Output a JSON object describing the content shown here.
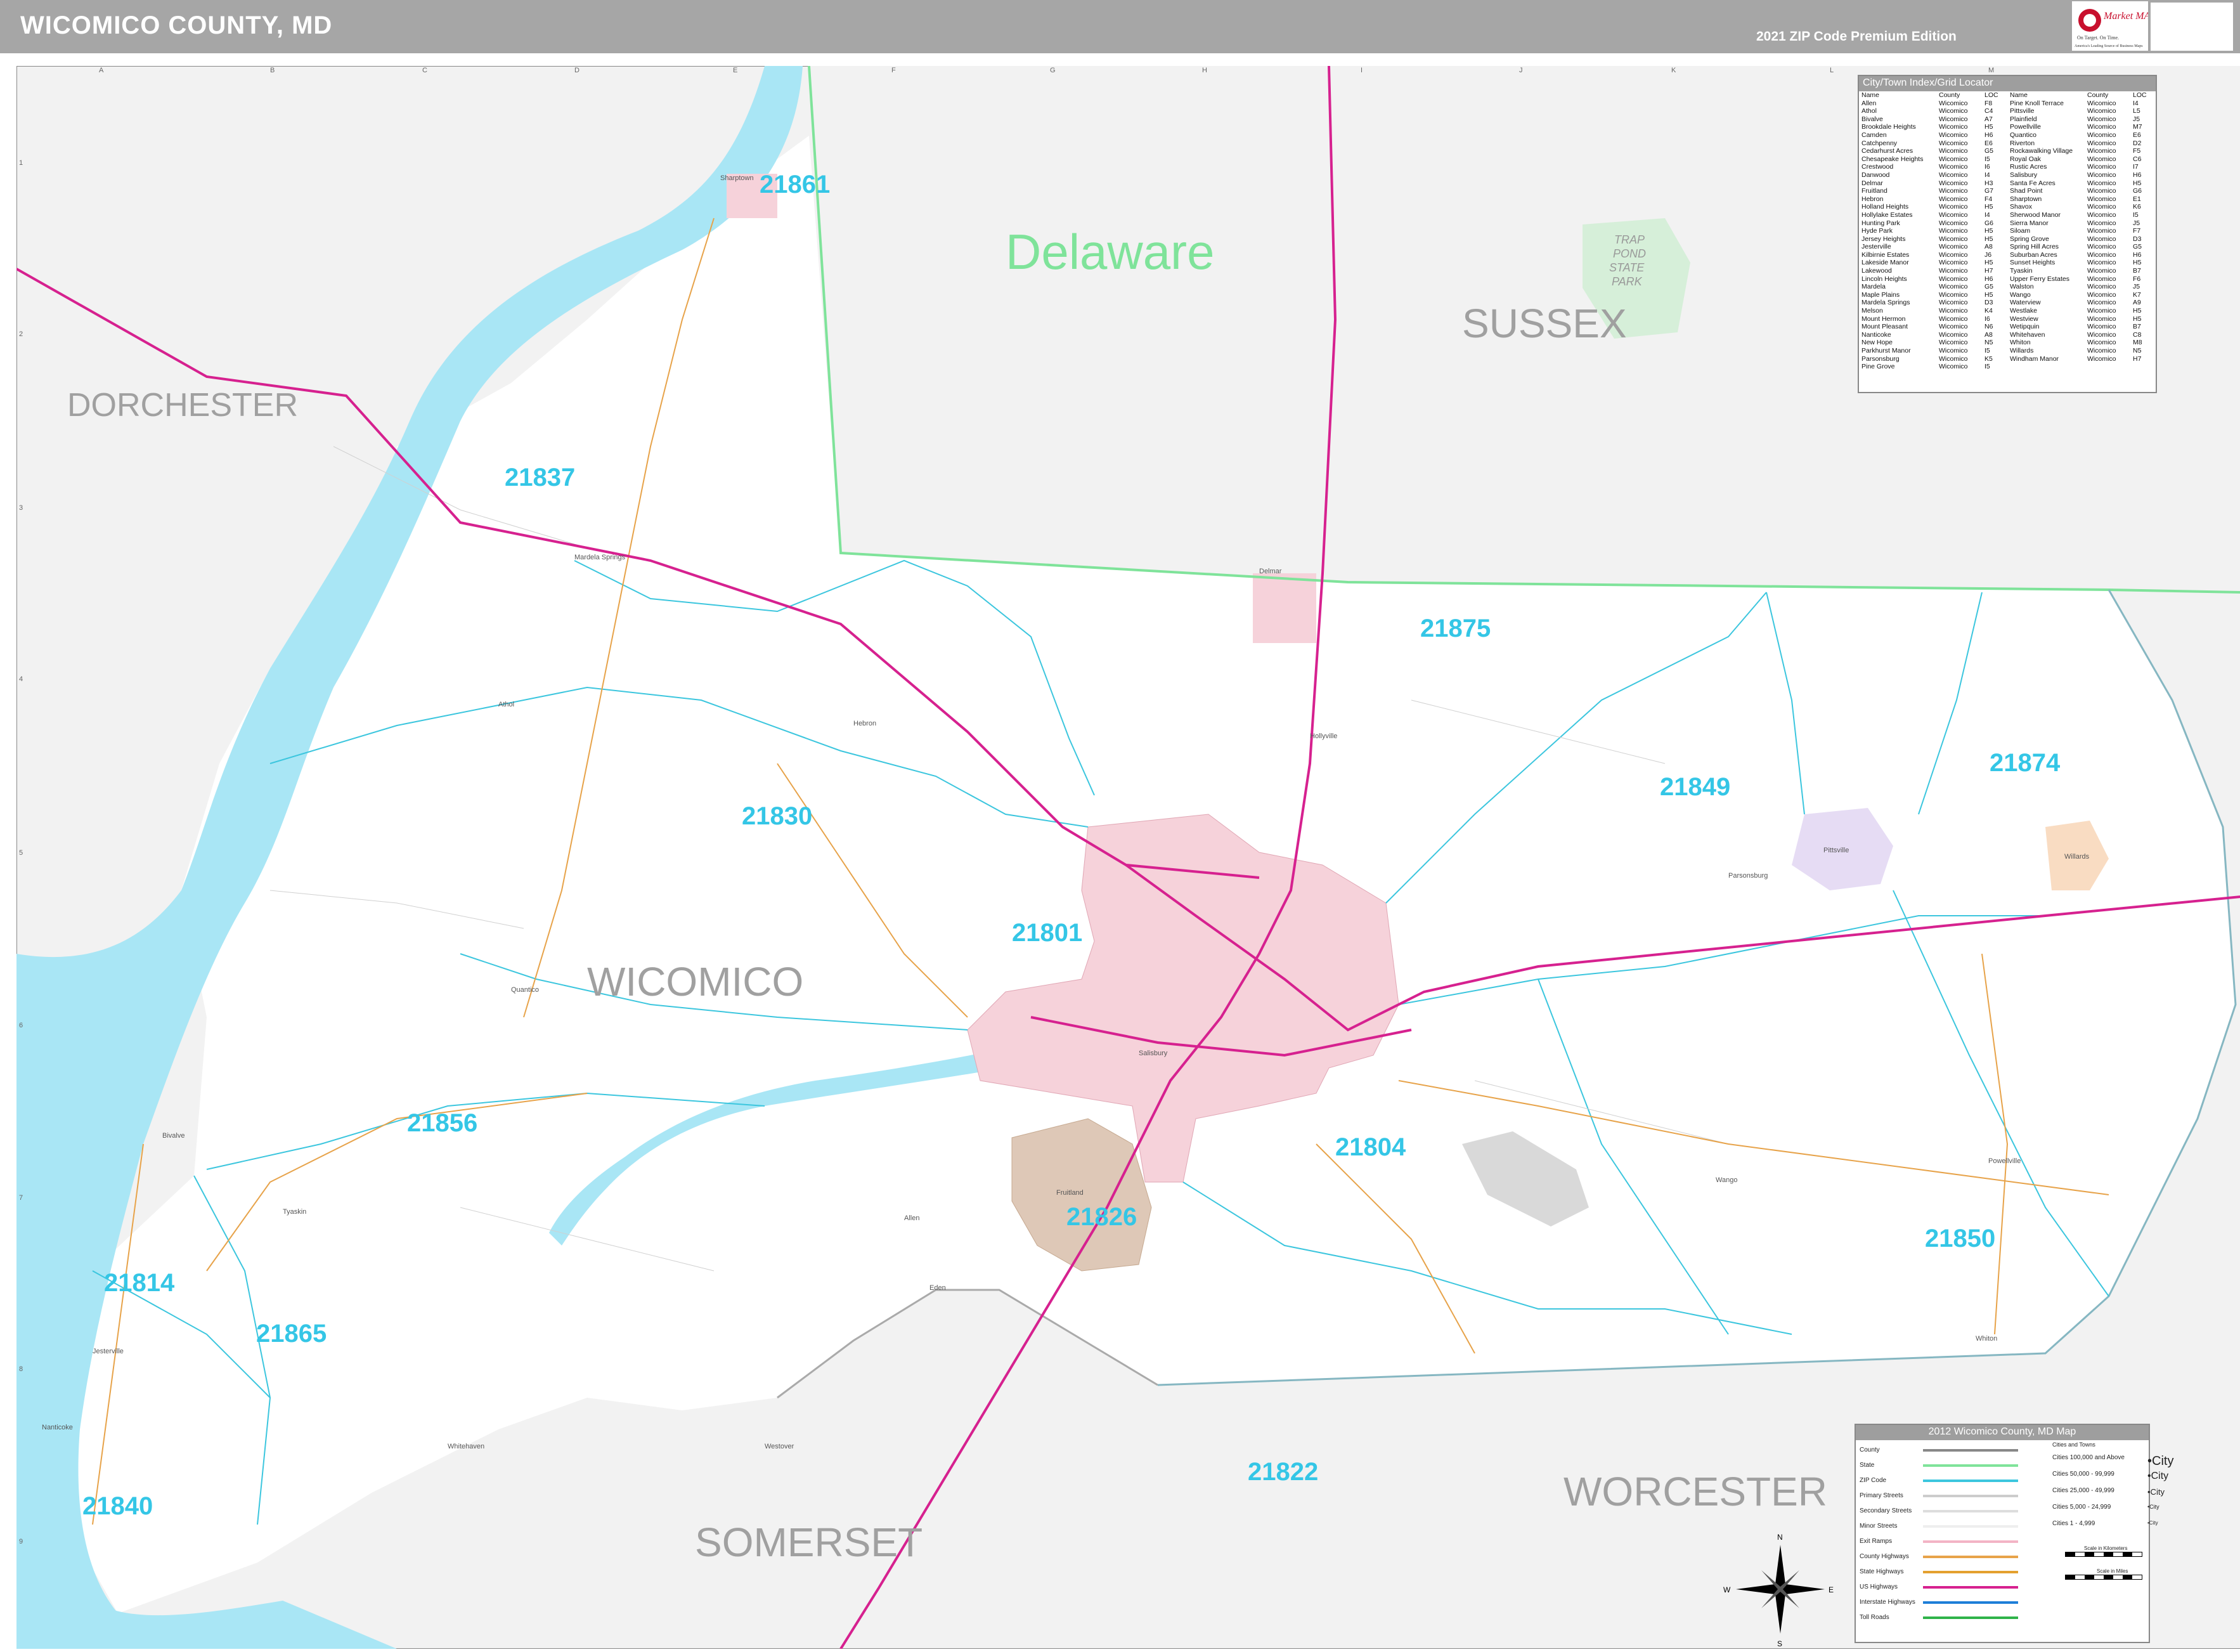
{
  "header": {
    "title": "WICOMICO COUNTY, MD",
    "edition": "2021 ZIP Code Premium Edition",
    "logo_text": "Market MAPS",
    "logo_tagline": "America's Leading Source of Business Maps",
    "logo_slogan": "On Target. On Time."
  },
  "grid": {
    "columns": [
      "A",
      "B",
      "C",
      "D",
      "E",
      "F",
      "G",
      "H",
      "I",
      "J",
      "K",
      "L",
      "M"
    ],
    "rows": [
      "1",
      "2",
      "3",
      "4",
      "5",
      "6",
      "7",
      "8",
      "9"
    ]
  },
  "map": {
    "state_label": "Delaware",
    "counties": [
      "DORCHESTER",
      "SUSSEX",
      "WICOMICO",
      "SOMERSET",
      "WORCESTER"
    ],
    "park_label": [
      "TRAP",
      "POND",
      "STATE",
      "PARK"
    ],
    "zip_codes": [
      "21861",
      "21837",
      "21875",
      "21874",
      "21849",
      "21830",
      "21801",
      "21856",
      "21804",
      "21826",
      "21850",
      "21814",
      "21865",
      "21840",
      "21822"
    ],
    "towns": [
      "Sharptown",
      "Mardela Springs",
      "Athol",
      "Hebron",
      "Delmar",
      "Salisbury",
      "Fruitland",
      "Allen",
      "Eden",
      "Tyaskin",
      "Nanticoke",
      "Whitehaven",
      "Quantico",
      "Pittsville",
      "Willards",
      "Parsonsburg",
      "Powellville",
      "Whiton",
      "Bivalve",
      "Jesterville",
      "Westover",
      "Hollyville",
      "Wango"
    ],
    "colors": {
      "water": "#a9e6f5",
      "outside_land": "#f2f2f2",
      "state_line": "#7fe39a",
      "zip_line": "#3cc6de",
      "us_highway": "#d6218f",
      "county_highway": "#e7a34a",
      "salisbury_fill": "#f6d2da",
      "fruitland_fill": "#dec8b7",
      "zip_label": "#34c6e6"
    }
  },
  "locator": {
    "title": "City/Town Index/Grid Locator",
    "headers": [
      "Name",
      "County",
      "LOC"
    ],
    "left": [
      [
        "Allen",
        "Wicomico",
        "F8"
      ],
      [
        "Athol",
        "Wicomico",
        "C4"
      ],
      [
        "Bivalve",
        "Wicomico",
        "A7"
      ],
      [
        "Brookdale Heights",
        "Wicomico",
        "H5"
      ],
      [
        "Camden",
        "Wicomico",
        "H6"
      ],
      [
        "Catchpenny",
        "Wicomico",
        "E6"
      ],
      [
        "Cedarhurst Acres",
        "Wicomico",
        "G5"
      ],
      [
        "Chesapeake Heights",
        "Wicomico",
        "I5"
      ],
      [
        "Crestwood",
        "Wicomico",
        "I6"
      ],
      [
        "Danwood",
        "Wicomico",
        "I4"
      ],
      [
        "Delmar",
        "Wicomico",
        "H3"
      ],
      [
        "Fruitland",
        "Wicomico",
        "G7"
      ],
      [
        "Hebron",
        "Wicomico",
        "F4"
      ],
      [
        "Holland Heights",
        "Wicomico",
        "H5"
      ],
      [
        "Hollylake Estates",
        "Wicomico",
        "I4"
      ],
      [
        "Hunting Park",
        "Wicomico",
        "G6"
      ],
      [
        "Hyde Park",
        "Wicomico",
        "H5"
      ],
      [
        "Jersey Heights",
        "Wicomico",
        "H5"
      ],
      [
        "Jesterville",
        "Wicomico",
        "A8"
      ],
      [
        "Kilbirnie Estates",
        "Wicomico",
        "J6"
      ],
      [
        "Lakeside Manor",
        "Wicomico",
        "H5"
      ],
      [
        "Lakewood",
        "Wicomico",
        "H7"
      ],
      [
        "Lincoln Heights",
        "Wicomico",
        "H6"
      ],
      [
        "Mardela",
        "Wicomico",
        "G5"
      ],
      [
        "Maple Plains",
        "Wicomico",
        "H5"
      ],
      [
        "Mardela Springs",
        "Wicomico",
        "D3"
      ],
      [
        "Melson",
        "Wicomico",
        "K4"
      ],
      [
        "Mount Hermon",
        "Wicomico",
        "I6"
      ],
      [
        "Mount Pleasant",
        "Wicomico",
        "N6"
      ],
      [
        "Nanticoke",
        "Wicomico",
        "A8"
      ],
      [
        "New Hope",
        "Wicomico",
        "N5"
      ],
      [
        "Parkhurst Manor",
        "Wicomico",
        "I5"
      ],
      [
        "Parsonsburg",
        "Wicomico",
        "K5"
      ],
      [
        "Pine Grove",
        "Wicomico",
        "I5"
      ]
    ],
    "right": [
      [
        "Pine Knoll Terrace",
        "Wicomico",
        "I4"
      ],
      [
        "Pittsville",
        "Wicomico",
        "L5"
      ],
      [
        "Plainfield",
        "Wicomico",
        "J5"
      ],
      [
        "Powellville",
        "Wicomico",
        "M7"
      ],
      [
        "Quantico",
        "Wicomico",
        "E6"
      ],
      [
        "Riverton",
        "Wicomico",
        "D2"
      ],
      [
        "Rockawalking Village",
        "Wicomico",
        "F5"
      ],
      [
        "Royal Oak",
        "Wicomico",
        "C6"
      ],
      [
        "Rustic Acres",
        "Wicomico",
        "I7"
      ],
      [
        "Salisbury",
        "Wicomico",
        "H6"
      ],
      [
        "Santa Fe Acres",
        "Wicomico",
        "H5"
      ],
      [
        "Shad Point",
        "Wicomico",
        "G6"
      ],
      [
        "Sharptown",
        "Wicomico",
        "E1"
      ],
      [
        "Shavox",
        "Wicomico",
        "K6"
      ],
      [
        "Sherwood Manor",
        "Wicomico",
        "I5"
      ],
      [
        "Sierra Manor",
        "Wicomico",
        "J5"
      ],
      [
        "Siloam",
        "Wicomico",
        "F7"
      ],
      [
        "Spring Grove",
        "Wicomico",
        "D3"
      ],
      [
        "Spring Hill Acres",
        "Wicomico",
        "G5"
      ],
      [
        "Suburban Acres",
        "Wicomico",
        "H6"
      ],
      [
        "Sunset Heights",
        "Wicomico",
        "H5"
      ],
      [
        "Tyaskin",
        "Wicomico",
        "B7"
      ],
      [
        "Upper Ferry Estates",
        "Wicomico",
        "F6"
      ],
      [
        "Walston",
        "Wicomico",
        "J5"
      ],
      [
        "Wango",
        "Wicomico",
        "K7"
      ],
      [
        "Waterview",
        "Wicomico",
        "A9"
      ],
      [
        "Westlake",
        "Wicomico",
        "H5"
      ],
      [
        "Westview",
        "Wicomico",
        "H5"
      ],
      [
        "Wetipquin",
        "Wicomico",
        "B7"
      ],
      [
        "Whitehaven",
        "Wicomico",
        "C8"
      ],
      [
        "Whiton",
        "Wicomico",
        "M8"
      ],
      [
        "Willards",
        "Wicomico",
        "N5"
      ],
      [
        "Windham Manor",
        "Wicomico",
        "H7"
      ]
    ]
  },
  "legend": {
    "title": "2012 Wicomico County, MD Map",
    "items": [
      "County",
      "State",
      "ZIP Code",
      "Primary Streets",
      "Secondary Streets",
      "Minor Streets",
      "Exit Ramps",
      "County Highways",
      "State Highways",
      "US Highways",
      "Interstate Highways",
      "Toll Roads"
    ],
    "line_colors": [
      "#888888",
      "#7fe39a",
      "#3cc6de",
      "#cccccc",
      "#dddddd",
      "#eeeeee",
      "#f3b4c5",
      "#e7a34a",
      "#e4a02f",
      "#d6218f",
      "#1e7ed8",
      "#2fb34a"
    ],
    "cities_header": "Cities and Towns",
    "cities": [
      [
        "Cities 100,000 and Above",
        "City"
      ],
      [
        "Cities 50,000 - 99,999",
        "City"
      ],
      [
        "Cities 25,000 - 49,999",
        "City"
      ],
      [
        "Cities 5,000 - 24,999",
        "City"
      ],
      [
        "Cities 1 - 4,999",
        "City"
      ]
    ],
    "scale_km": "Scale in Kilometers",
    "scale_mi": "Scale in Miles",
    "compass": [
      "N",
      "S",
      "E",
      "W"
    ]
  }
}
